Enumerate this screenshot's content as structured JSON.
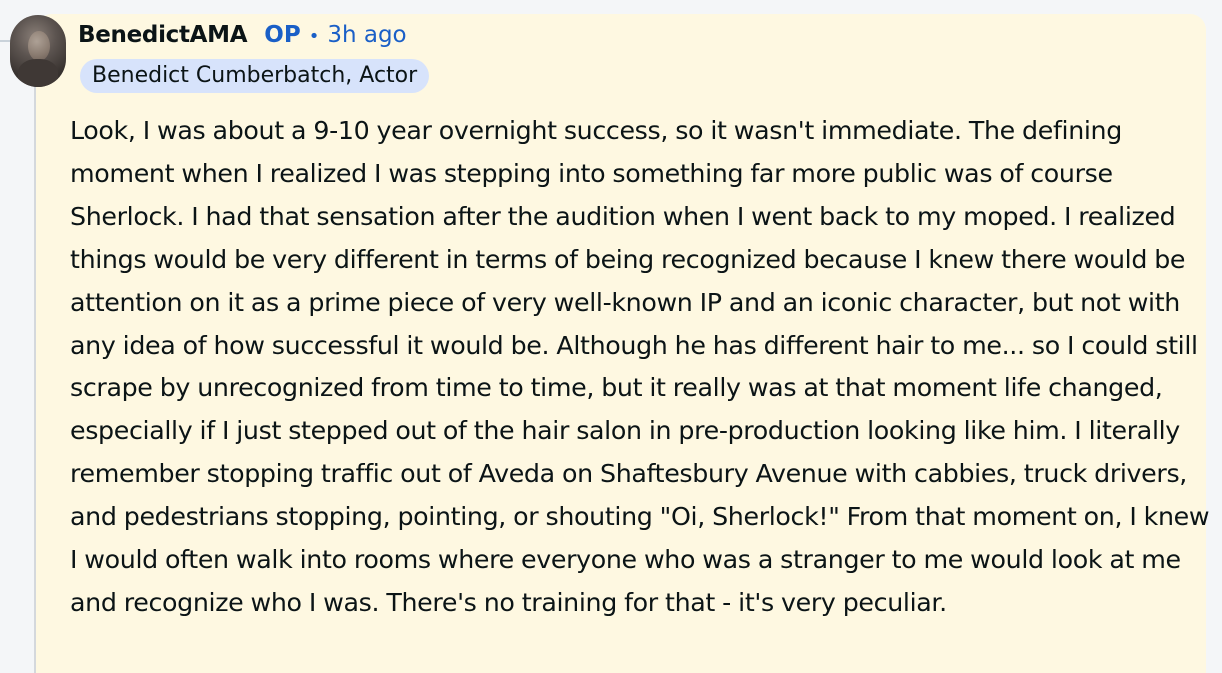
{
  "comment": {
    "author": "BenedictAMA",
    "op_label": "OP",
    "separator": "•",
    "timestamp": "3h ago",
    "flair": "Benedict Cumberbatch, Actor",
    "body": "Look, I was about a 9-10 year overnight success, so it wasn't immediate. The defining moment when I realized I was stepping into something far more public was of course Sherlock. I had that sensation after the audition when I went back to my moped. I realized things would be very different in terms of being recognized because I knew there would be attention on it as a prime piece of very well-known IP and an iconic character, but not with any idea of how successful it would be. Although he has different hair to me... so I could still scrape by unrecognized from time to time, but it really was at that moment life changed, especially if I just stepped out of the hair salon in pre-production looking like him. I literally remember stopping traffic out of Aveda on Shaftesbury Avenue with cabbies, truck drivers, and pedestrians stopping, pointing, or shouting \"Oi, Sherlock!\" From that moment on, I knew I would often walk into rooms where everyone who was a stranger to me would look at me and recognize who I was. There's no training for that - it's very peculiar."
  },
  "colors": {
    "card_background": "#fef8e1",
    "op_accent": "#1a5fc7",
    "flair_background": "#d7e3fb",
    "text": "#0b1416"
  },
  "icons": {
    "avatar": "user-avatar-image"
  }
}
